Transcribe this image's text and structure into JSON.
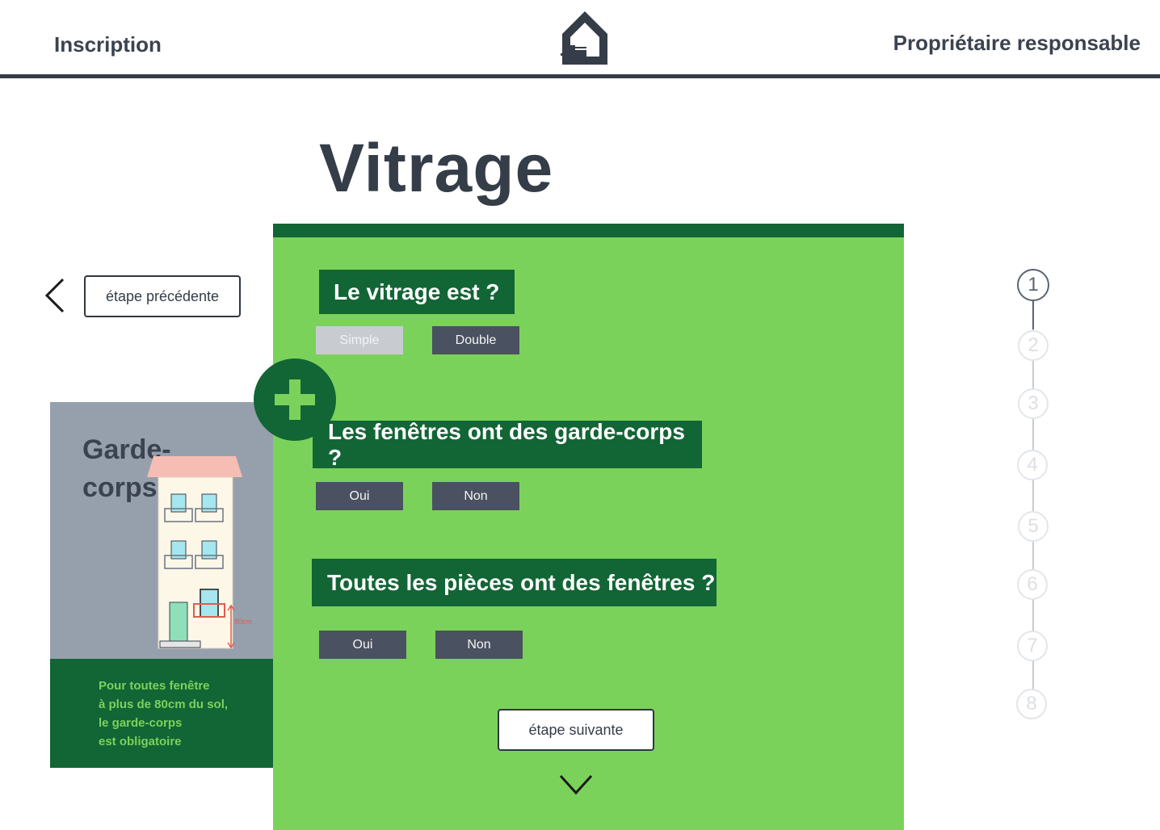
{
  "header": {
    "left_link": "Inscription",
    "right_link": "Propriétaire responsable",
    "logo_icon": "house-logo-icon"
  },
  "page": {
    "title": "Vitrage"
  },
  "navigation": {
    "prev_label": "étape précédente",
    "next_label": "étape suivante"
  },
  "side_card": {
    "title_line1": "Garde-",
    "title_line2": "corps",
    "info_lines": [
      "Pour toutes fenêtre",
      "à plus de 80cm du sol,",
      "le garde-corps",
      "est obligatoire"
    ],
    "illustration_label": "80cm"
  },
  "questions": [
    {
      "label": "Le vitrage est ?",
      "options": [
        "Simple",
        "Double"
      ],
      "disabled_option": "Simple"
    },
    {
      "label": "Les fenêtres ont des garde-corps ?",
      "options": [
        "Oui",
        "Non"
      ]
    },
    {
      "label": "Toutes les pièces ont des fenêtres ?",
      "options": [
        "Oui",
        "Non"
      ]
    }
  ],
  "stepper": {
    "steps": [
      "1",
      "2",
      "3",
      "4",
      "5",
      "6",
      "7",
      "8"
    ],
    "current": "1"
  },
  "colors": {
    "dark_green": "#126535",
    "light_green": "#7bd25b",
    "slate": "#343d48",
    "button_dark": "#4a5160",
    "card_gray": "#96a0ad"
  }
}
